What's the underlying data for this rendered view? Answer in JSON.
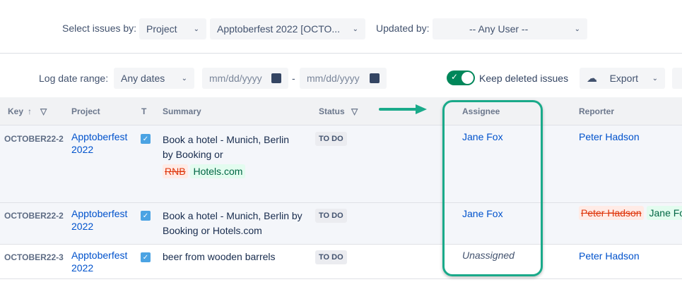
{
  "filters": {
    "select_issues_label": "Select issues by:",
    "select_by_value": "Project",
    "project_value": "Apptoberfest 2022 [OCTO...",
    "updated_by_label": "Updated by:",
    "updated_by_value": "-- Any User --",
    "log_date_label": "Log date range:",
    "date_range_value": "Any dates",
    "date_from_placeholder": "mm/dd/yyyy",
    "date_sep": "-",
    "date_to_placeholder": "mm/dd/yyyy",
    "keep_deleted_label": "Keep deleted issues",
    "keep_deleted_on": true,
    "export_label": "Export"
  },
  "table": {
    "headers": {
      "key": "Key",
      "project": "Project",
      "type": "T",
      "summary": "Summary",
      "status": "Status",
      "assignee": "Assignee",
      "reporter": "Reporter"
    },
    "rows": [
      {
        "key": "OCTOBER22-2",
        "project": "Apptoberfest 2022",
        "summary": "Book a hotel - Munich, Berlin by Booking or",
        "summary_deleted": "RNB",
        "summary_inserted": "Hotels.com",
        "status": "TO DO",
        "assignee": "Jane Fox",
        "reporter": "Peter Hadson"
      },
      {
        "key": "OCTOBER22-2",
        "project": "Apptoberfest 2022",
        "summary": "Book a hotel - Munich, Berlin by Booking or Hotels.com",
        "status": "TO DO",
        "assignee": "Jane Fox",
        "reporter_deleted": "Peter Hadson",
        "reporter_inserted": "Jane Fox"
      },
      {
        "key": "OCTOBER22-3",
        "project": "Apptoberfest 2022",
        "summary": "beer from wooden barrels",
        "status": "TO DO",
        "assignee": "Unassigned",
        "reporter": "Peter Hadson"
      }
    ]
  },
  "colors": {
    "accent": "#1aaa8a",
    "link": "#0052cc",
    "toggle": "#00875a"
  }
}
